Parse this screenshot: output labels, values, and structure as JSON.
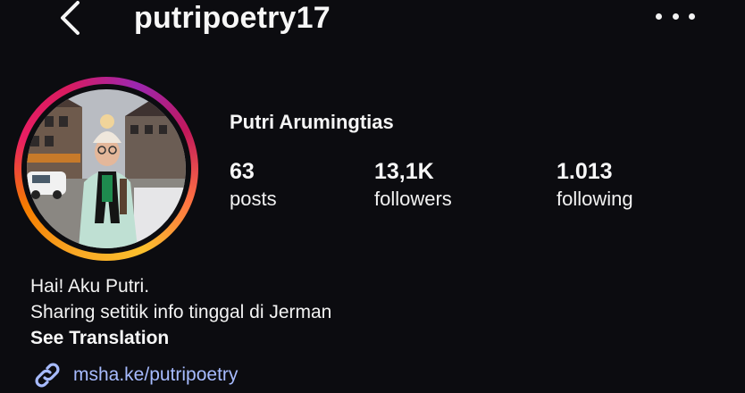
{
  "header": {
    "username": "putripoetry17",
    "back_icon": "chevron-left-icon",
    "more_icon": "more-horizontal-icon"
  },
  "profile": {
    "full_name": "Putri Arumingtias",
    "story_ring_colors": [
      "#f9a825",
      "#e91e63",
      "#9c27b0"
    ]
  },
  "stats": [
    {
      "value": "63",
      "label": "posts"
    },
    {
      "value": "13,1K",
      "label": "followers"
    },
    {
      "value": "1.013",
      "label": "following"
    }
  ],
  "bio": {
    "lines": [
      "Hai! Aku Putri.",
      "Sharing setitik info tinggal di Jerman"
    ],
    "see_translation": "See Translation",
    "link_icon": "link-icon",
    "link_text": "msha.ke/putripoetry",
    "link_color": "#a7bbff"
  }
}
